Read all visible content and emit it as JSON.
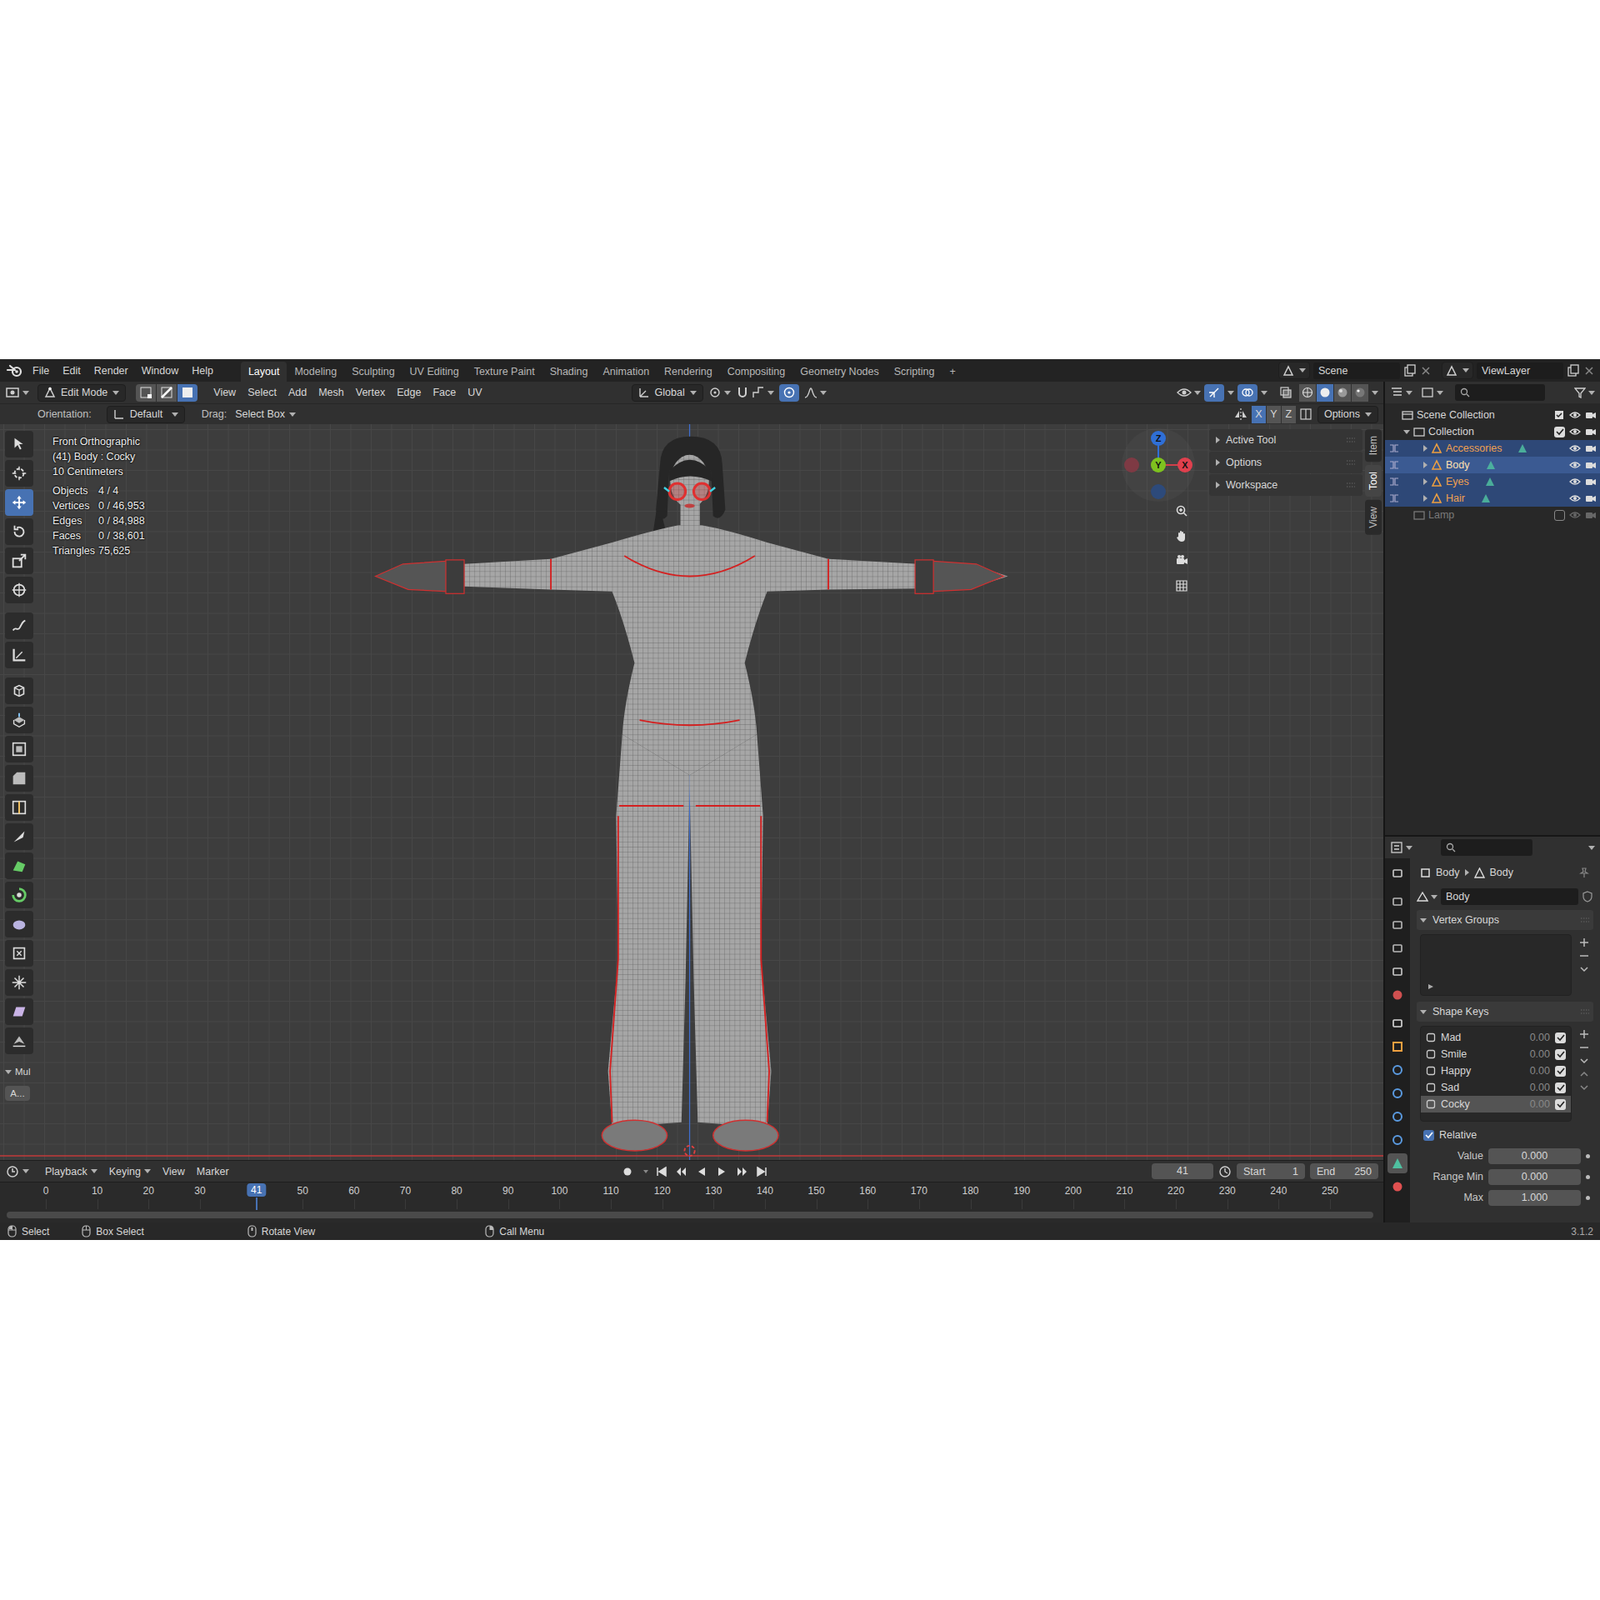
{
  "topbar": {
    "menus": [
      "File",
      "Edit",
      "Render",
      "Window",
      "Help"
    ],
    "workspaces": [
      {
        "label": "Layout",
        "selected": true
      },
      {
        "label": "Modeling",
        "selected": false
      },
      {
        "label": "Sculpting",
        "selected": false
      },
      {
        "label": "UV Editing",
        "selected": false
      },
      {
        "label": "Texture Paint",
        "selected": false
      },
      {
        "label": "Shading",
        "selected": false
      },
      {
        "label": "Animation",
        "selected": false
      },
      {
        "label": "Rendering",
        "selected": false
      },
      {
        "label": "Compositing",
        "selected": false
      },
      {
        "label": "Geometry Nodes",
        "selected": false
      },
      {
        "label": "Scripting",
        "selected": false
      }
    ],
    "add_workspace": "+",
    "scene": "Scene",
    "view_layer": "ViewLayer"
  },
  "viewport_header": {
    "mode": "Edit Mode",
    "select_modes": [
      {
        "selected": false
      },
      {
        "selected": false
      },
      {
        "selected": true
      }
    ],
    "menus": [
      "View",
      "Select",
      "Add",
      "Mesh",
      "Vertex",
      "Edge",
      "Face",
      "UV"
    ],
    "transform_orientation": "Global",
    "proportional_editing": true,
    "gizmos": true,
    "overlays": true,
    "shading_modes": [
      {
        "selected": false
      },
      {
        "selected": true
      },
      {
        "selected": false
      },
      {
        "selected": false
      }
    ]
  },
  "tool_settings": {
    "orientation_label": "Orientation:",
    "orientation": "Default",
    "drag_label": "Drag:",
    "drag": "Select Box",
    "mirror_axes": [
      {
        "label": "X",
        "selected": true
      },
      {
        "label": "Y",
        "selected": false
      },
      {
        "label": "Z",
        "selected": false
      }
    ],
    "options": "Options"
  },
  "toolbar": {
    "tools": [
      {
        "selected": false
      },
      {
        "selected": false
      },
      {
        "selected": true
      },
      {
        "selected": false
      },
      {
        "selected": false
      },
      {
        "selected": false
      },
      {
        "selected": false
      },
      {
        "selected": false
      },
      {
        "selected": false
      },
      {
        "selected": false
      },
      {
        "selected": false
      },
      {
        "selected": false
      },
      {
        "selected": false
      },
      {
        "selected": false
      },
      {
        "selected": false
      },
      {
        "selected": false
      },
      {
        "selected": false
      },
      {
        "selected": false
      },
      {
        "selected": false
      },
      {
        "selected": false
      },
      {
        "selected": false
      }
    ],
    "operator_panel": "Mul",
    "operator_button": "A..."
  },
  "overlay": {
    "view": "Front Orthographic",
    "object": "(41) Body : Cocky",
    "grid_scale": "10 Centimeters",
    "stats": [
      {
        "label": "Objects",
        "value": "4 / 4"
      },
      {
        "label": "Vertices",
        "value": "0 / 46,953"
      },
      {
        "label": "Edges",
        "value": "0 / 84,988"
      },
      {
        "label": "Faces",
        "value": "0 / 38,601"
      },
      {
        "label": "Triangles",
        "value": "75,625"
      }
    ]
  },
  "gizmo": {
    "x": "X",
    "y": "Y",
    "z": "Z"
  },
  "sidebar": {
    "tabs": [
      {
        "label": "Item",
        "selected": false
      },
      {
        "label": "Tool",
        "selected": true
      },
      {
        "label": "View",
        "selected": false
      }
    ],
    "sections": [
      {
        "label": "Active Tool",
        "expanded": false
      },
      {
        "label": "Options",
        "expanded": false
      },
      {
        "label": "Workspace",
        "expanded": false
      }
    ]
  },
  "outliner": {
    "root": "Scene Collection",
    "collections": [
      {
        "label": "Collection",
        "checked": true,
        "expanded": true,
        "objects": [
          {
            "label": "Accessories",
            "selected": true,
            "active": false,
            "expanded": false
          },
          {
            "label": "Body",
            "selected": true,
            "active": true,
            "expanded": false
          },
          {
            "label": "Eyes",
            "selected": true,
            "active": false,
            "expanded": false
          },
          {
            "label": "Hair",
            "selected": true,
            "active": false,
            "expanded": false
          }
        ]
      },
      {
        "label": "Lamp",
        "checked": false,
        "objects": []
      }
    ]
  },
  "properties": {
    "tabs": [
      {
        "selected": false
      },
      {
        "selected": false
      },
      {
        "selected": false
      },
      {
        "selected": false
      },
      {
        "selected": false
      },
      {
        "selected": false
      },
      {
        "selected": false
      },
      {
        "selected": false
      },
      {
        "selected": false
      },
      {
        "selected": false
      },
      {
        "selected": false
      },
      {
        "selected": false
      },
      {
        "selected": true
      },
      {
        "selected": false
      }
    ],
    "breadcrumb": [
      "Body",
      "Body"
    ],
    "mesh": "Body",
    "vertex_groups": {
      "title": "Vertex Groups",
      "expanded": true,
      "items": []
    },
    "shape_keys": {
      "title": "Shape Keys",
      "expanded": true,
      "items": [
        {
          "name": "Mad",
          "value": "0.00",
          "enabled": true,
          "selected": false
        },
        {
          "name": "Smile",
          "value": "0.00",
          "enabled": true,
          "selected": false
        },
        {
          "name": "Happy",
          "value": "0.00",
          "enabled": true,
          "selected": false
        },
        {
          "name": "Sad",
          "value": "0.00",
          "enabled": true,
          "selected": false
        },
        {
          "name": "Cocky",
          "value": "0.00",
          "enabled": true,
          "selected": true
        }
      ]
    },
    "relative": {
      "label": "Relative",
      "checked": true
    },
    "fields": [
      {
        "label": "Value",
        "value": "0.000"
      },
      {
        "label": "Range Min",
        "value": "0.000"
      },
      {
        "label": "Max",
        "value": "1.000"
      }
    ]
  },
  "timeline": {
    "menus": [
      {
        "label": "Playback",
        "kind": "dropdown"
      },
      {
        "label": "Keying",
        "kind": "dropdown"
      },
      {
        "label": "View",
        "kind": "menu"
      },
      {
        "label": "Marker",
        "kind": "menu"
      }
    ],
    "current_frame": "41",
    "start_label": "Start",
    "start": "1",
    "end_label": "End",
    "end": "250",
    "ruler": [
      "0",
      "10",
      "20",
      "30",
      "50",
      "60",
      "70",
      "80",
      "90",
      "100",
      "110",
      "120",
      "130",
      "140",
      "150",
      "160",
      "170",
      "180",
      "190",
      "200",
      "210",
      "220",
      "230",
      "240",
      "250"
    ],
    "playhead": "41"
  },
  "status_bar": {
    "items": [
      "Select",
      "Box Select",
      "Rotate View",
      "Call Menu"
    ],
    "version": "3.1.2"
  }
}
